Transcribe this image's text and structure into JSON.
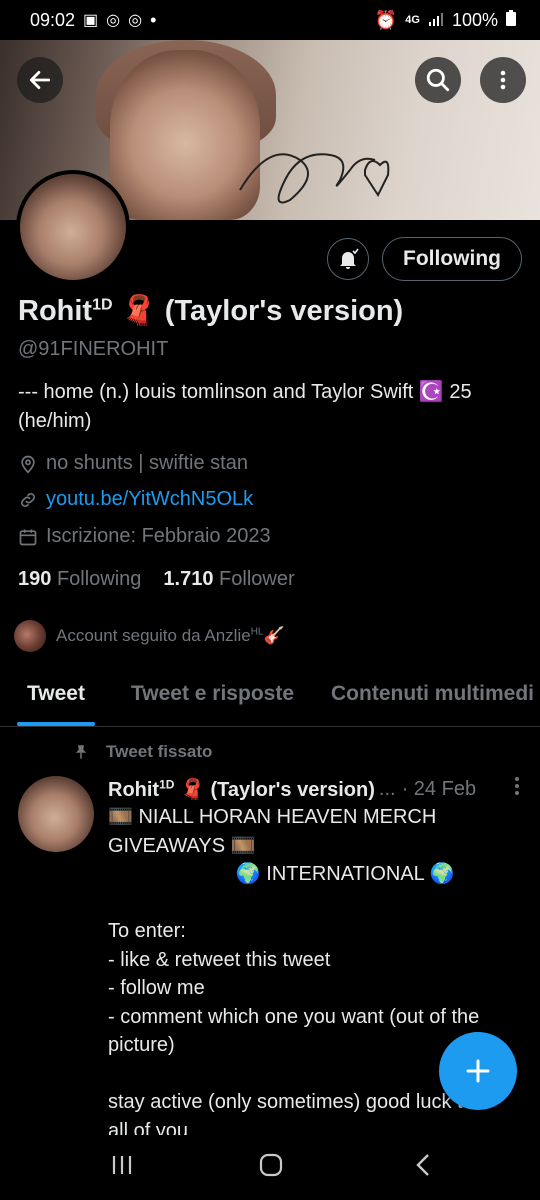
{
  "status_bar": {
    "time": "09:02",
    "dot": "•",
    "network": "4G",
    "battery": "100%"
  },
  "profile": {
    "name": "Rohit",
    "name_sup": "1D",
    "name_emoji": "🧣",
    "name_suffix": "(Taylor's version)",
    "handle": "@91FINEROHIT",
    "bio": "--- home (n.) louis tomlinson and Taylor Swift ☪️ 25 (he/him)",
    "location": "no shunts | swiftie stan",
    "link": "youtu.be/YitWchN5OLk",
    "joined": "Iscrizione: Febbraio 2023",
    "following_count": "190",
    "following_label": "Following",
    "followers_count": "1.710",
    "followers_label": "Follower",
    "followed_by": "Account seguito da Anzlie",
    "followed_by_sup": "HL",
    "followed_by_emoji": "🎸",
    "follow_button_label": "Following"
  },
  "tabs": [
    {
      "label": "Tweet",
      "active": true
    },
    {
      "label": "Tweet e risposte",
      "active": false
    },
    {
      "label": "Contenuti multimedi",
      "active": false
    }
  ],
  "tweet": {
    "pinned_label": "Tweet fissato",
    "author": "Rohit",
    "author_sup": "1D",
    "author_rest": "🧣 (Taylor's version)",
    "ellipsis": "...",
    "date": "· 24 Feb",
    "lines": [
      "🎞️ NIALL HORAN HEAVEN MERCH",
      "GIVEAWAYS 🎞️",
      "                       🌍 INTERNATIONAL 🌍",
      "",
      "To enter:",
      "- like & retweet this tweet",
      "- follow me",
      "- comment which one you want (out of the",
      "picture)",
      "",
      "stay active (only sometimes) good luck to",
      "all of you"
    ]
  },
  "icons": {
    "back": "arrow-left-icon",
    "search": "search-icon",
    "more": "more-vertical-icon",
    "bell": "bell-icon",
    "location": "location-pin-icon",
    "link": "link-icon",
    "calendar": "calendar-icon",
    "pin": "pin-icon",
    "compose": "plus-icon"
  },
  "colors": {
    "accent": "#1d9bf0",
    "background": "#000000",
    "muted": "#71767b"
  }
}
